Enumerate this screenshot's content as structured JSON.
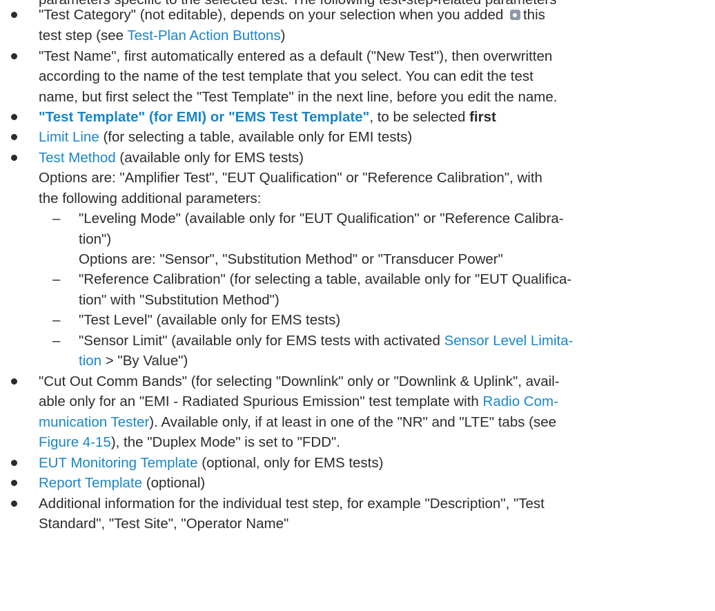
{
  "cut_line": "parameters specific to the selected test. The following test-step-related parameters",
  "items": {
    "category": {
      "a": "\"Test Category\" (not editable), depends on your selection when you added",
      "b": "this",
      "c": "test step (see",
      "link": "Test-Plan Action Buttons",
      "d": ")"
    },
    "test_name": {
      "l1": "\"Test Name\", first automatically entered as a default (\"New Test\"), then overwritten",
      "l2": "according to the name of the test template that you select. You can edit the test",
      "l3": "name, but first select the \"Test Template\" in the next line, before you edit the name."
    },
    "template": {
      "link": "\"Test Template\" (for EMI) or \"EMS Test Template\"",
      "text": ", to be selected",
      "bold": "first"
    },
    "limit_line": {
      "link": "Limit Line",
      "text": "(for selecting a table, available only for EMI tests)"
    },
    "test_method": {
      "link": "Test Method",
      "text": "(available only for EMS tests)",
      "l2": "Options are: \"Amplifier Test\", \"EUT Qualification\" or \"Reference Calibration\", with",
      "l3": "the following additional parameters:"
    },
    "sub": {
      "dash": "–",
      "leveling_1": "\"Leveling Mode\" (available only for \"EUT Qualification\" or \"Reference Calibra-",
      "leveling_2": "tion\")",
      "leveling_3": "Options are: \"Sensor\", \"Substitution Method\" or \"Transducer Power\"",
      "refcal_1": "\"Reference Calibration\" (for selecting a table, available only for \"EUT Qualifica-",
      "refcal_2": "tion\" with \"Substitution Method\")",
      "testlevel": "\"Test Level\" (available only for EMS tests)",
      "sensor_1": "\"Sensor Limit\" (available only for EMS tests with activated",
      "sensor_link_1": "Sensor Level Limita-",
      "sensor_link_2": "tion",
      "sensor_2": "> \"By Value\")"
    },
    "cutout": {
      "l1": "\"Cut Out Comm Bands\" (for selecting \"Downlink\" only or \"Downlink & Uplink\", avail-",
      "l2a": "able only for an \"EMI - Radiated Spurious Emission\" test template with",
      "l2link": "Radio Com-",
      "l3link": "munication Tester",
      "l3": "). Available only, if at least in one of the \"NR\" and \"LTE\" tabs (see",
      "l4link": "Figure 4-15",
      "l4": "), the \"Duplex Mode\" is set to \"FDD\"."
    },
    "eut": {
      "link": "EUT Monitoring Template",
      "text": "(optional, only for EMS tests)"
    },
    "report": {
      "link": "Report Template",
      "text": "(optional)"
    },
    "additional": {
      "l1": "Additional information for the individual test step, for example \"Description\", \"Test",
      "l2": "Standard\", \"Test Site\", \"Operator Name\""
    }
  }
}
